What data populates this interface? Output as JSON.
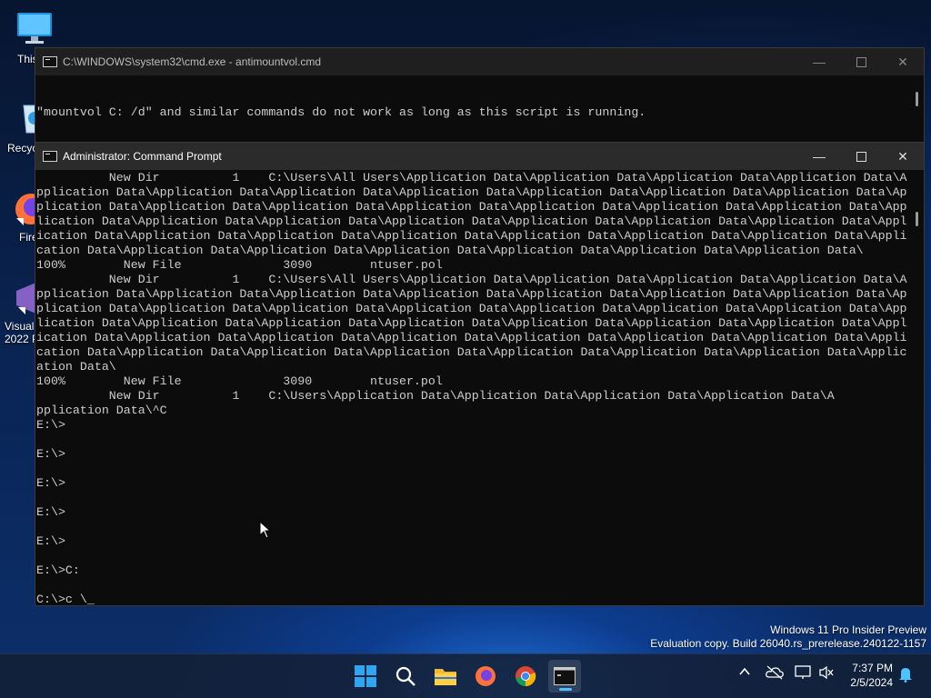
{
  "desktop": {
    "icons": [
      {
        "label": "This",
        "icon": "monitor-icon"
      },
      {
        "label": "Recyc",
        "icon": "recycle-bin-icon"
      },
      {
        "label": "Fire",
        "icon": "firefox-icon"
      },
      {
        "label": "Visual\n2022 P",
        "icon": "visual-studio-icon"
      }
    ]
  },
  "window_back": {
    "title": "C:\\WINDOWS\\system32\\cmd.exe - antimountvol.cmd",
    "console_lines": [
      "\"mountvol C: /d\" and similar commands do not work as long as this script is running."
    ]
  },
  "window_front": {
    "title": "Administrator: Command Prompt",
    "console_lines": [
      "          New Dir          1    C:\\Users\\All Users\\Application Data\\Application Data\\Application Data\\Application Data\\A",
      "pplication Data\\Application Data\\Application Data\\Application Data\\Application Data\\Application Data\\Application Data\\Ap",
      "plication Data\\Application Data\\Application Data\\Application Data\\Application Data\\Application Data\\Application Data\\App",
      "lication Data\\Application Data\\Application Data\\Application Data\\Application Data\\Application Data\\Application Data\\Appl",
      "ication Data\\Application Data\\Application Data\\Application Data\\Application Data\\Application Data\\Application Data\\Appli",
      "cation Data\\Application Data\\Application Data\\Application Data\\Application Data\\Application Data\\Application Data\\",
      "100%        New File              3090        ntuser.pol",
      "          New Dir          1    C:\\Users\\All Users\\Application Data\\Application Data\\Application Data\\Application Data\\A",
      "pplication Data\\Application Data\\Application Data\\Application Data\\Application Data\\Application Data\\Application Data\\Ap",
      "plication Data\\Application Data\\Application Data\\Application Data\\Application Data\\Application Data\\Application Data\\App",
      "lication Data\\Application Data\\Application Data\\Application Data\\Application Data\\Application Data\\Application Data\\Appl",
      "ication Data\\Application Data\\Application Data\\Application Data\\Application Data\\Application Data\\Application Data\\Appli",
      "cation Data\\Application Data\\Application Data\\Application Data\\Application Data\\Application Data\\Application Data\\Applic",
      "ation Data\\",
      "100%        New File              3090        ntuser.pol",
      "          New Dir          1    C:\\Users\\Application Data\\Application Data\\Application Data\\Application Data\\A",
      "pplication Data\\^C",
      "E:\\>",
      "",
      "E:\\>",
      "",
      "E:\\>",
      "",
      "E:\\>",
      "",
      "E:\\>",
      "",
      "E:\\>C:",
      "",
      "C:\\>c \\_"
    ]
  },
  "watermark": {
    "line1": "Windows 11 Pro Insider Preview",
    "line2": "Evaluation copy. Build 26040.rs_prerelease.240122-1157"
  },
  "taskbar": {
    "apps": [
      "windows-start-icon",
      "search-icon",
      "file-explorer-icon",
      "firefox-icon",
      "chrome-icon",
      "terminal-icon"
    ],
    "clock_time": "7:37 PM",
    "clock_date": "2/5/2024"
  },
  "colors": {
    "console_text": "#cccccc",
    "console_bg": "#0c0c0c",
    "accent": "#4cc2ff"
  }
}
